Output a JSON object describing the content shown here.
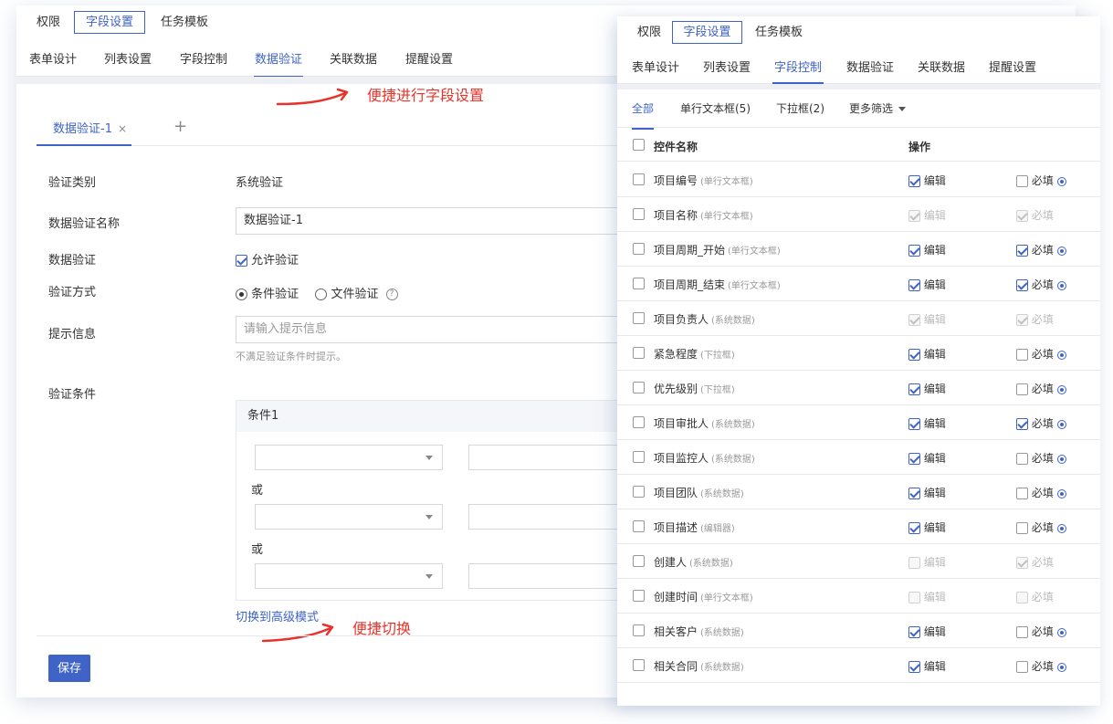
{
  "left": {
    "top_tabs": [
      "权限",
      "字段设置",
      "任务模板"
    ],
    "sub_tabs": [
      "表单设计",
      "列表设置",
      "字段控制",
      "数据验证",
      "关联数据",
      "提醒设置"
    ],
    "annotation_top": "便捷进行字段设置",
    "doc_tab": "数据验证-1",
    "doc_tab_close": "×",
    "add_tab": "+",
    "form": {
      "type_label": "验证类别",
      "type_value": "系统验证",
      "name_label": "数据验证名称",
      "name_value": "数据验证-1",
      "validate_label": "数据验证",
      "allow_label": "允许验证",
      "method_label": "验证方式",
      "method_condition": "条件验证",
      "method_file": "文件验证",
      "help_glyph": "?",
      "hint_label": "提示信息",
      "hint_placeholder": "请输入提示信息",
      "hint_helper": "不满足验证条件时提示。",
      "cond_label": "验证条件",
      "cond_title": "条件1",
      "or_text": "或"
    },
    "switch_link": "切换到高级模式",
    "annotation_bottom": "便捷切换",
    "save_label": "保存"
  },
  "right": {
    "top_tabs": [
      "权限",
      "字段设置",
      "任务模板"
    ],
    "sub_tabs": [
      "表单设计",
      "列表设置",
      "字段控制",
      "数据验证",
      "关联数据",
      "提醒设置"
    ],
    "filters": [
      "全部",
      "单行文本框(5)",
      "下拉框(2)",
      "更多筛选"
    ],
    "col_name": "控件名称",
    "col_op": "操作",
    "edit_label": "编辑",
    "req_label": "必填",
    "rows": [
      {
        "name": "项目编号",
        "type": "(单行文本框)",
        "edit": true,
        "edit_dis": false,
        "req": false,
        "req_dis": false,
        "info": true
      },
      {
        "name": "项目名称",
        "type": "(单行文本框)",
        "edit": true,
        "edit_dis": true,
        "req": true,
        "req_dis": true,
        "info": false
      },
      {
        "name": "项目周期_开始",
        "type": "(单行文本框)",
        "edit": true,
        "edit_dis": false,
        "req": true,
        "req_dis": false,
        "info": true
      },
      {
        "name": "项目周期_结束",
        "type": "(单行文本框)",
        "edit": true,
        "edit_dis": false,
        "req": true,
        "req_dis": false,
        "info": true
      },
      {
        "name": "项目负责人",
        "type": "(系统数据)",
        "edit": true,
        "edit_dis": true,
        "req": true,
        "req_dis": true,
        "info": false
      },
      {
        "name": "紧急程度",
        "type": "(下拉框)",
        "edit": true,
        "edit_dis": false,
        "req": false,
        "req_dis": false,
        "info": true
      },
      {
        "name": "优先级别",
        "type": "(下拉框)",
        "edit": true,
        "edit_dis": false,
        "req": false,
        "req_dis": false,
        "info": true
      },
      {
        "name": "项目审批人",
        "type": "(系统数据)",
        "edit": true,
        "edit_dis": false,
        "req": true,
        "req_dis": false,
        "info": true
      },
      {
        "name": "项目监控人",
        "type": "(系统数据)",
        "edit": true,
        "edit_dis": false,
        "req": false,
        "req_dis": false,
        "info": true
      },
      {
        "name": "项目团队",
        "type": "(系统数据)",
        "edit": true,
        "edit_dis": false,
        "req": false,
        "req_dis": false,
        "info": true
      },
      {
        "name": "项目描述",
        "type": "(编辑器)",
        "edit": true,
        "edit_dis": false,
        "req": false,
        "req_dis": false,
        "info": true
      },
      {
        "name": "创建人",
        "type": "(系统数据)",
        "edit": false,
        "edit_dis": true,
        "req": true,
        "req_dis": true,
        "info": false
      },
      {
        "name": "创建时间",
        "type": "(单行文本框)",
        "edit": false,
        "edit_dis": true,
        "req": false,
        "req_dis": true,
        "info": false
      },
      {
        "name": "相关客户",
        "type": "(系统数据)",
        "edit": true,
        "edit_dis": false,
        "req": false,
        "req_dis": false,
        "info": true
      },
      {
        "name": "相关合同",
        "type": "(系统数据)",
        "edit": true,
        "edit_dis": false,
        "req": false,
        "req_dis": false,
        "info": true
      }
    ]
  },
  "colors": {
    "accent": "#3f63c6",
    "annotation": "#e8332a",
    "border": "#e6e8ee"
  }
}
